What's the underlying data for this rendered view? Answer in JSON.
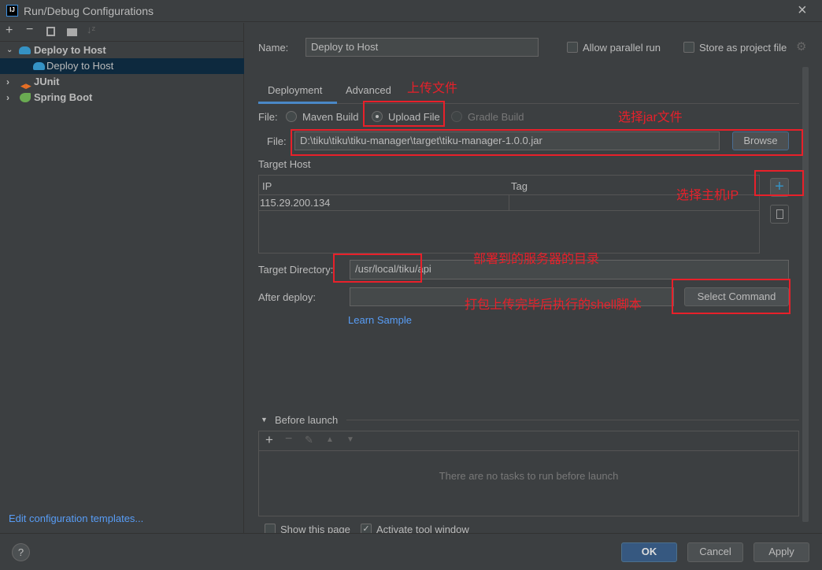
{
  "window": {
    "title": "Run/Debug Configurations",
    "close": "×"
  },
  "sidebar": {
    "toolbar": [
      "add-icon",
      "remove-icon",
      "copy-icon",
      "new-folder-icon",
      "sort-icon"
    ],
    "items": [
      {
        "label": "Deploy to Host",
        "expanded": true,
        "bold": true
      },
      {
        "label": "Deploy to Host",
        "selected": true
      },
      {
        "label": "JUnit",
        "bold": true
      },
      {
        "label": "Spring Boot",
        "bold": true
      }
    ],
    "edit_templates": "Edit configuration templates..."
  },
  "form": {
    "name_label": "Name:",
    "name_value": "Deploy to Host",
    "allow_parallel": "Allow parallel run",
    "store_project": "Store as project file",
    "tabs": [
      "Deployment",
      "Advanced"
    ],
    "active_tab": "Deployment",
    "file_label": "File:",
    "radios": [
      "Maven Build",
      "Upload File",
      "Gradle Build"
    ],
    "selected_radio": "Upload File",
    "file_path_label": "File:",
    "file_path": "D:\\tiku\\tiku\\tiku-manager\\target\\tiku-manager-1.0.0.jar",
    "browse": "Browse",
    "target_host_label": "Target Host",
    "host_columns": [
      "IP",
      "Tag"
    ],
    "host_rows": [
      [
        "115.29.200.134",
        ""
      ]
    ],
    "target_dir_label": "Target Directory:",
    "target_dir": "/usr/local/tiku/api",
    "after_deploy_label": "After deploy:",
    "after_deploy": "",
    "select_command": "Select Command",
    "learn_sample": "Learn Sample",
    "before_launch": "Before launch",
    "before_launch_empty": "There are no tasks to run before launch",
    "show_page": "Show this page",
    "activate_tool": "Activate tool window",
    "activate_checked": true
  },
  "annotations": {
    "upload": "上传文件",
    "jar": "选择jar文件",
    "host": "选择主机IP",
    "dir": "部署到的服务器的目录",
    "shell": "打包上传完毕后执行的shell脚本"
  },
  "footer": {
    "help": "?",
    "ok": "OK",
    "cancel": "Cancel",
    "apply": "Apply"
  },
  "colors": {
    "accent": "#4a88c7",
    "selection": "#0d293e",
    "annotation": "#e8202a",
    "ok": "#365880"
  }
}
